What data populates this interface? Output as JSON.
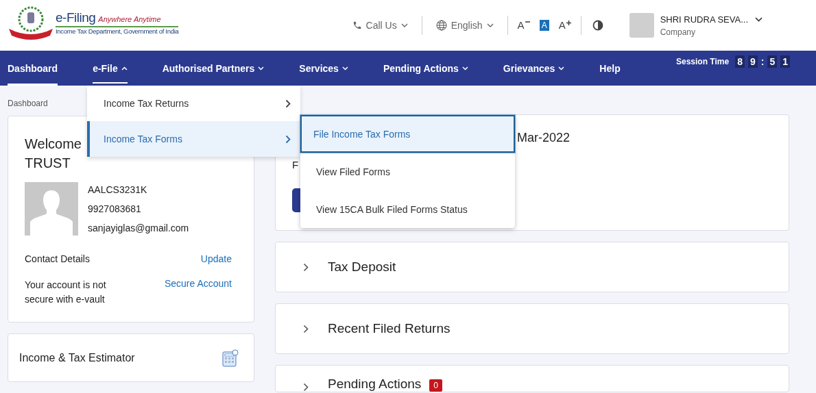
{
  "logo": {
    "title": "e-Filing",
    "tagline": "Anywhere Anytime",
    "subtitle": "Income Tax Department, Government of India"
  },
  "toolbar": {
    "call_us": "Call Us",
    "language": "English",
    "text_sizes": [
      {
        "kind": "decrease",
        "label": "A",
        "selected": false
      },
      {
        "kind": "normal",
        "label": "A",
        "selected": true
      },
      {
        "kind": "increase",
        "label": "A",
        "selected": false
      }
    ]
  },
  "user": {
    "name": "SHRI RUDRA SEVA...",
    "role": "Company"
  },
  "nav": [
    {
      "label": "Dashboard",
      "selected": true,
      "has_menu": false
    },
    {
      "label": "e-File",
      "selected": false,
      "has_menu": true,
      "expanded": true
    },
    {
      "label": "Authorised Partners",
      "selected": false,
      "has_menu": true,
      "expanded": false
    },
    {
      "label": "Services",
      "selected": false,
      "has_menu": true,
      "expanded": false
    },
    {
      "label": "Pending Actions",
      "selected": false,
      "has_menu": true,
      "expanded": false
    },
    {
      "label": "Grievances",
      "selected": false,
      "has_menu": true,
      "expanded": false
    },
    {
      "label": "Help",
      "selected": false,
      "has_menu": false
    }
  ],
  "session": {
    "label": "Session Time",
    "digits": [
      "8",
      "9",
      ":",
      "5",
      "1"
    ]
  },
  "breadcrumb": "Dashboard",
  "menu": [
    {
      "label": "Income Tax Returns",
      "selected": false
    },
    {
      "label": "Income Tax Forms",
      "selected": true
    }
  ],
  "submenu": [
    {
      "label": "File Income Tax Forms",
      "selected": true
    },
    {
      "label": "View Filed Forms",
      "selected": false
    },
    {
      "label": "View 15CA Bulk Filed Forms Status",
      "selected": false
    }
  ],
  "profile": {
    "welcome_lines": [
      "Welcome",
      "TRUST"
    ],
    "pan": "AALCS3231K",
    "phone": "9927083681",
    "email": "sanjayiglas@gmail.com",
    "contact_label": "Contact Details",
    "contact_link": "Update",
    "secure_text": "Your account is not secure with e-vault",
    "secure_link": "Secure Account"
  },
  "estimator": "Income & Tax Estimator",
  "filing_card": {
    "title_visible": "Mar-2022",
    "text_visible": "F"
  },
  "sections": [
    {
      "title": "Tax Deposit",
      "expanded": false
    },
    {
      "title": "Recent Filed Returns",
      "expanded": false
    },
    {
      "title": "Pending Actions",
      "expanded": false,
      "badge": "0"
    }
  ]
}
